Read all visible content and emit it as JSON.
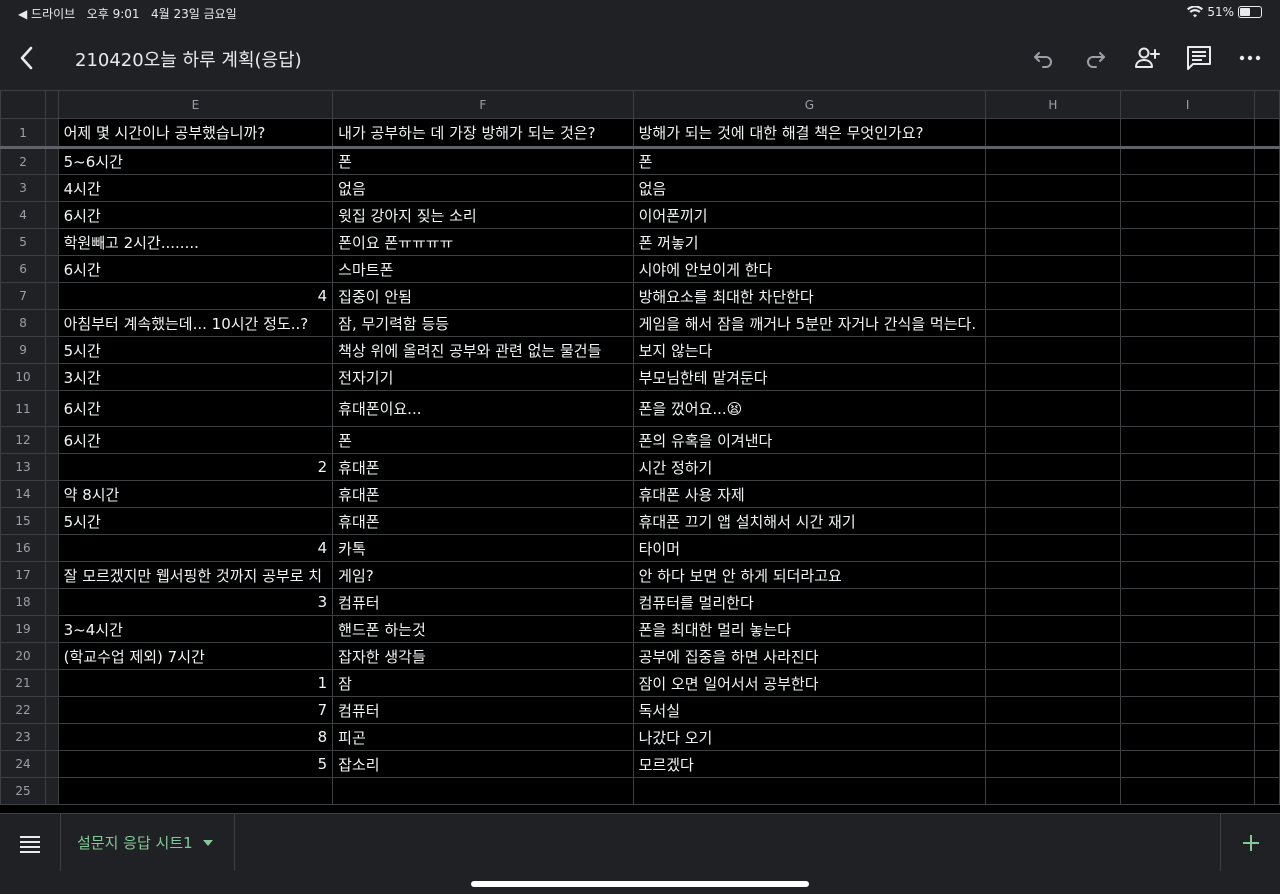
{
  "status": {
    "back_app": "◀ 드라이브",
    "time": "오후 9:01",
    "date": "4월 23일 금요일",
    "battery": "51%",
    "battery_level": 0.51
  },
  "header": {
    "title": "210420오늘 하루 계획(응답)"
  },
  "columns": [
    "E",
    "F",
    "G",
    "H",
    "I"
  ],
  "rows": [
    {
      "n": "1",
      "e": "어제 몇 시간이나 공부했습니까?",
      "f": "내가 공부하는 데 가장 방해가 되는 것은?",
      "g": "방해가 되는 것에 대한 해결 책은 무엇인가요?"
    },
    {
      "n": "2",
      "e": "5~6시간",
      "f": "폰",
      "g": "폰"
    },
    {
      "n": "3",
      "e": "4시간",
      "f": "없음",
      "g": "없음"
    },
    {
      "n": "4",
      "e": "6시간",
      "f": "윗집 강아지 짖는 소리",
      "g": "이어폰끼기"
    },
    {
      "n": "5",
      "e": "학원빼고 2시간........",
      "f": "폰이요 폰ㅠㅠㅠㅠ",
      "g": "폰 꺼놓기"
    },
    {
      "n": "6",
      "e": "6시간",
      "f": "스마트폰",
      "g": "시야에 안보이게 한다"
    },
    {
      "n": "7",
      "e": "4",
      "f": "집중이 안됨",
      "g": "방해요소를 최대한 차단한다"
    },
    {
      "n": "8",
      "e": "아침부터 계속했는데... 10시간 정도..?",
      "f": "잠, 무기력함 등등",
      "g": "게임을 해서 잠을 깨거나 5분만 자거나 간식을 먹는다."
    },
    {
      "n": "9",
      "e": "5시간",
      "f": "책상 위에 올려진 공부와 관련 없는 물건들",
      "g": "보지 않는다"
    },
    {
      "n": "10",
      "e": "3시간",
      "f": "전자기기",
      "g": "부모님한테 맡겨둔다"
    },
    {
      "n": "11",
      "e": "6시간",
      "f": "휴대폰이요...",
      "g": "폰을 껐어요...😫"
    },
    {
      "n": "12",
      "e": "6시간",
      "f": "폰",
      "g": "폰의 유혹을 이겨낸다"
    },
    {
      "n": "13",
      "e": "2",
      "f": "휴대폰",
      "g": "시간 정하기"
    },
    {
      "n": "14",
      "e": "약 8시간",
      "f": "휴대폰",
      "g": "휴대폰 사용 자제"
    },
    {
      "n": "15",
      "e": "5시간",
      "f": "휴대폰",
      "g": "휴대폰 끄기 앱 설치해서 시간 재기"
    },
    {
      "n": "16",
      "e": "4",
      "f": "카톡",
      "g": "타이머"
    },
    {
      "n": "17",
      "e": "잘 모르겠지만 웹서핑한 것까지 공부로 치",
      "f": "게임?",
      "g": "안 하다 보면 안 하게 되더라고요"
    },
    {
      "n": "18",
      "e": "3",
      "f": "컴퓨터",
      "g": "컴퓨터를 멀리한다"
    },
    {
      "n": "19",
      "e": "3~4시간",
      "f": "핸드폰 하는것",
      "g": "폰을 최대한 멀리 놓는다"
    },
    {
      "n": "20",
      "e": "(학교수업 제외) 7시간",
      "f": "잡자한 생각들",
      "g": "공부에 집중을 하면 사라진다"
    },
    {
      "n": "21",
      "e": "1",
      "f": "잠",
      "g": "잠이 오면 일어서서 공부한다"
    },
    {
      "n": "22",
      "e": "7",
      "f": "컴퓨터",
      "g": "독서실"
    },
    {
      "n": "23",
      "e": "8",
      "f": "피곤",
      "g": "나갔다 오기"
    },
    {
      "n": "24",
      "e": "5",
      "f": "잡소리",
      "g": "모르겠다"
    },
    {
      "n": "25",
      "e": "",
      "f": "",
      "g": ""
    }
  ],
  "sheet_tab": {
    "name": "설문지 응답 시트1"
  }
}
